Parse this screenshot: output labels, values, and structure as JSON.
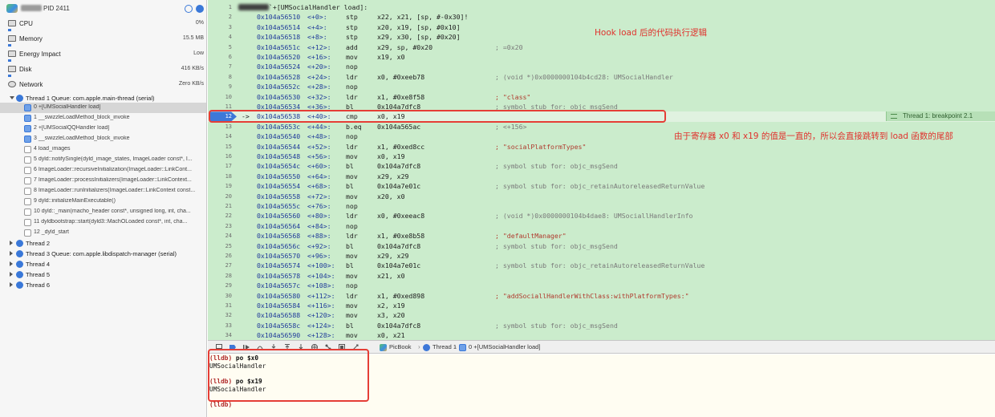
{
  "process": {
    "title": "PID 2411"
  },
  "gauges": [
    {
      "label": "CPU",
      "value": "0%"
    },
    {
      "label": "Memory",
      "value": "15.5 MB"
    },
    {
      "label": "Energy Impact",
      "value": "Low"
    },
    {
      "label": "Disk",
      "value": "416 KB/s"
    },
    {
      "label": "Network",
      "value": "Zero KB/s"
    }
  ],
  "thread1": {
    "label": "Thread 1 Queue: com.apple.main-thread (serial)",
    "frames": [
      "0 +[UMSocialHandler load]",
      "1 __swizzleLoadMethod_block_invoke",
      "2 +[UMSocialQQHandler load]",
      "3 __swizzleLoadMethod_block_invoke",
      "4 load_images",
      "5 dyld::notifySingle(dyld_image_states, ImageLoader const*, I...",
      "6 ImageLoader::recursiveInitialization(ImageLoader::LinkCont...",
      "7 ImageLoader::processInitializers(ImageLoader::LinkContext...",
      "8 ImageLoader::runInitializers(ImageLoader::LinkContext const...",
      "9 dyld::initializeMainExecutable()",
      "10 dyld::_main(macho_header const*, unsigned long, int, cha...",
      "11 dyldbootstrap::start(dyld3::MachOLoaded const*, int, cha...",
      "12 _dyld_start"
    ]
  },
  "other_threads": [
    "Thread 2",
    "Thread 3 Queue: com.apple.libdispatch-manager (serial)",
    "Thread 4",
    "Thread 5",
    "Thread 6"
  ],
  "editor": {
    "header": "`+[UMSocialHandler load]:",
    "lines": [
      {
        "n": "2",
        "addr": "0x104a56510",
        "off": "<+0>:",
        "mn": "stp",
        "ops": "x22, x21, [sp, #-0x30]!",
        "cmt": ""
      },
      {
        "n": "3",
        "addr": "0x104a56514",
        "off": "<+4>:",
        "mn": "stp",
        "ops": "x20, x19, [sp, #0x10]",
        "cmt": ""
      },
      {
        "n": "4",
        "addr": "0x104a56518",
        "off": "<+8>:",
        "mn": "stp",
        "ops": "x29, x30, [sp, #0x20]",
        "cmt": ""
      },
      {
        "n": "5",
        "addr": "0x104a5651c",
        "off": "<+12>:",
        "mn": "add",
        "ops": "x29, sp, #0x20",
        "cmt": "; =0x20"
      },
      {
        "n": "6",
        "addr": "0x104a56520",
        "off": "<+16>:",
        "mn": "mov",
        "ops": "x19, x0",
        "cmt": ""
      },
      {
        "n": "7",
        "addr": "0x104a56524",
        "off": "<+20>:",
        "mn": "nop",
        "ops": "",
        "cmt": ""
      },
      {
        "n": "8",
        "addr": "0x104a56528",
        "off": "<+24>:",
        "mn": "ldr",
        "ops": "x0, #0xeeb78",
        "cmt": "; (void *)0x0000000104b4cd28: UMSocialHandler"
      },
      {
        "n": "9",
        "addr": "0x104a5652c",
        "off": "<+28>:",
        "mn": "nop",
        "ops": "",
        "cmt": ""
      },
      {
        "n": "10",
        "addr": "0x104a56530",
        "off": "<+32>:",
        "mn": "ldr",
        "ops": "x1, #0xe8f58",
        "cmt": "; \"class\""
      },
      {
        "n": "11",
        "addr": "0x104a56534",
        "off": "<+36>:",
        "mn": "bl",
        "ops": "0x104a7dfc8",
        "cmt": "; symbol stub for: objc_msgSend"
      },
      {
        "n": "12",
        "addr": "0x104a56538",
        "off": "<+40>:",
        "mn": "cmp",
        "ops": "x0, x19",
        "cmt": ""
      },
      {
        "n": "13",
        "addr": "0x104a5653c",
        "off": "<+44>:",
        "mn": "b.eq",
        "ops": "0x104a565ac",
        "cmt": "; <+156>"
      },
      {
        "n": "14",
        "addr": "0x104a56540",
        "off": "<+48>:",
        "mn": "nop",
        "ops": "",
        "cmt": ""
      },
      {
        "n": "15",
        "addr": "0x104a56544",
        "off": "<+52>:",
        "mn": "ldr",
        "ops": "x1, #0xed8cc",
        "cmt": "; \"socialPlatformTypes\""
      },
      {
        "n": "16",
        "addr": "0x104a56548",
        "off": "<+56>:",
        "mn": "mov",
        "ops": "x0, x19",
        "cmt": ""
      },
      {
        "n": "17",
        "addr": "0x104a5654c",
        "off": "<+60>:",
        "mn": "bl",
        "ops": "0x104a7dfc8",
        "cmt": "; symbol stub for: objc_msgSend"
      },
      {
        "n": "18",
        "addr": "0x104a56550",
        "off": "<+64>:",
        "mn": "mov",
        "ops": "x29, x29",
        "cmt": ""
      },
      {
        "n": "19",
        "addr": "0x104a56554",
        "off": "<+68>:",
        "mn": "bl",
        "ops": "0x104a7e01c",
        "cmt": "; symbol stub for: objc_retainAutoreleasedReturnValue"
      },
      {
        "n": "20",
        "addr": "0x104a56558",
        "off": "<+72>:",
        "mn": "mov",
        "ops": "x20, x0",
        "cmt": ""
      },
      {
        "n": "21",
        "addr": "0x104a5655c",
        "off": "<+76>:",
        "mn": "nop",
        "ops": "",
        "cmt": ""
      },
      {
        "n": "22",
        "addr": "0x104a56560",
        "off": "<+80>:",
        "mn": "ldr",
        "ops": "x0, #0xeeac8",
        "cmt": "; (void *)0x0000000104b4dae8: UMSociallHandlerInfo"
      },
      {
        "n": "23",
        "addr": "0x104a56564",
        "off": "<+84>:",
        "mn": "nop",
        "ops": "",
        "cmt": ""
      },
      {
        "n": "24",
        "addr": "0x104a56568",
        "off": "<+88>:",
        "mn": "ldr",
        "ops": "x1, #0xe8b58",
        "cmt": "; \"defaultManager\""
      },
      {
        "n": "25",
        "addr": "0x104a5656c",
        "off": "<+92>:",
        "mn": "bl",
        "ops": "0x104a7dfc8",
        "cmt": "; symbol stub for: objc_msgSend"
      },
      {
        "n": "26",
        "addr": "0x104a56570",
        "off": "<+96>:",
        "mn": "mov",
        "ops": "x29, x29",
        "cmt": ""
      },
      {
        "n": "27",
        "addr": "0x104a56574",
        "off": "<+100>:",
        "mn": "bl",
        "ops": "0x104a7e01c",
        "cmt": "; symbol stub for: objc_retainAutoreleasedReturnValue"
      },
      {
        "n": "28",
        "addr": "0x104a56578",
        "off": "<+104>:",
        "mn": "mov",
        "ops": "x21, x0",
        "cmt": ""
      },
      {
        "n": "29",
        "addr": "0x104a5657c",
        "off": "<+108>:",
        "mn": "nop",
        "ops": "",
        "cmt": ""
      },
      {
        "n": "30",
        "addr": "0x104a56580",
        "off": "<+112>:",
        "mn": "ldr",
        "ops": "x1, #0xed898",
        "cmt": "; \"addSociallHandlerWithClass:withPlatformTypes:\""
      },
      {
        "n": "31",
        "addr": "0x104a56584",
        "off": "<+116>:",
        "mn": "mov",
        "ops": "x2, x19",
        "cmt": ""
      },
      {
        "n": "32",
        "addr": "0x104a56588",
        "off": "<+120>:",
        "mn": "mov",
        "ops": "x3, x20",
        "cmt": ""
      },
      {
        "n": "33",
        "addr": "0x104a5658c",
        "off": "<+124>:",
        "mn": "bl",
        "ops": "0x104a7dfc8",
        "cmt": "; symbol stub for: objc_msgSend"
      },
      {
        "n": "34",
        "addr": "0x104a56590",
        "off": "<+128>:",
        "mn": "mov",
        "ops": "x0, x21",
        "cmt": ""
      }
    ],
    "current_line": "12",
    "pc_arrow": "->",
    "breakpoint_label": "Thread 1: breakpoint 2.1",
    "annotation_top": "Hook load 后的代码执行逻辑",
    "annotation_mid": "由于寄存器 x0 和 x19 的值是一直的，所以会直接跳转到 load 函数的尾部"
  },
  "debugbar": {
    "crumbs": [
      "PicBook",
      "Thread 1",
      "0 +[UMSocialHandler load]"
    ]
  },
  "console": {
    "prompt": "(lldb)",
    "cmd1": "po $x0",
    "out1": "UMSocialHandler",
    "cmd2": "po $x19",
    "out2": "UMSocialHandler"
  },
  "colors": {
    "editor_bg": "#cbeccc",
    "annotation": "#e0322d",
    "highlight_box": "#e53e36",
    "pc_marker": "#3d78d8"
  }
}
